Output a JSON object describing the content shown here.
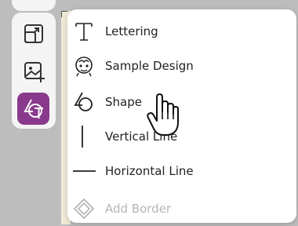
{
  "menu": {
    "items": [
      {
        "label": "Lettering",
        "icon": "lettering-t-icon",
        "enabled": true
      },
      {
        "label": "Sample Design",
        "icon": "sample-design-icon",
        "enabled": true
      },
      {
        "label": "Shape",
        "icon": "shape-icon",
        "enabled": true
      },
      {
        "label": "Vertical Line",
        "icon": "vertical-line-icon",
        "enabled": true
      },
      {
        "label": "Horizontal Line",
        "icon": "horizontal-line-icon",
        "enabled": true
      },
      {
        "label": "Add Border",
        "icon": "add-border-icon",
        "enabled": false
      }
    ]
  },
  "toolbar": {
    "tools": [
      {
        "icon": "resize-box-icon",
        "active": false
      },
      {
        "icon": "add-image-icon",
        "active": false
      },
      {
        "icon": "add-shape-text-icon",
        "active": true
      }
    ]
  },
  "colors": {
    "accent": "#8a3a8c",
    "toolbar_bg": "#bdbdbd",
    "panel_bg": "#f4f4f4",
    "menu_bg": "#ffffff",
    "text": "#222222",
    "disabled_text": "#b5b5b5"
  }
}
